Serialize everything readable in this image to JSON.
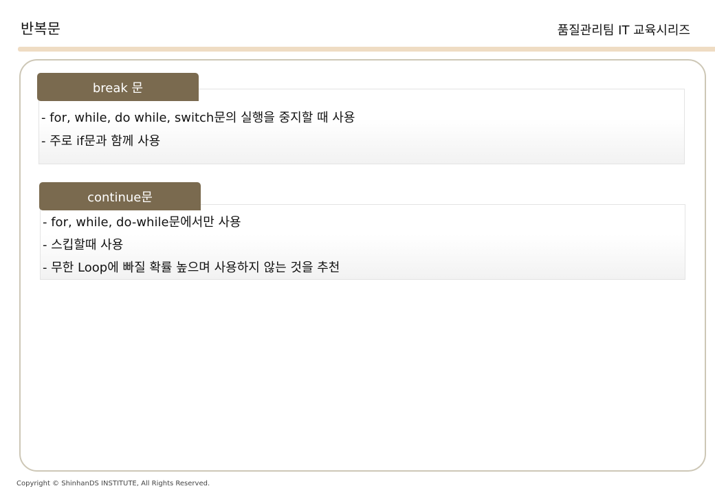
{
  "header": {
    "title": "반복문",
    "series": "품질관리팀 IT 교육시리즈"
  },
  "sections": [
    {
      "tag": "break 문",
      "lines": [
        "- for, while, do  while, switch문의 실행을 중지할 때 사용",
        "- 주로 if문과 함께 사용"
      ]
    },
    {
      "tag": "continue문",
      "lines": [
        "- for, while, do-while문에서만 사용",
        "- 스킵할때 사용",
        "- 무한 Loop에 빠질 확률 높으며 사용하지 않는 것을 추천"
      ]
    }
  ],
  "footer": {
    "copyright": "Copyright © ShinhanDS INSTITUTE, All Rights Reserved."
  },
  "colors": {
    "accent_bar": "#efdcc3",
    "tag_background": "#7a6a4f",
    "frame_border": "#cdc7b6"
  }
}
